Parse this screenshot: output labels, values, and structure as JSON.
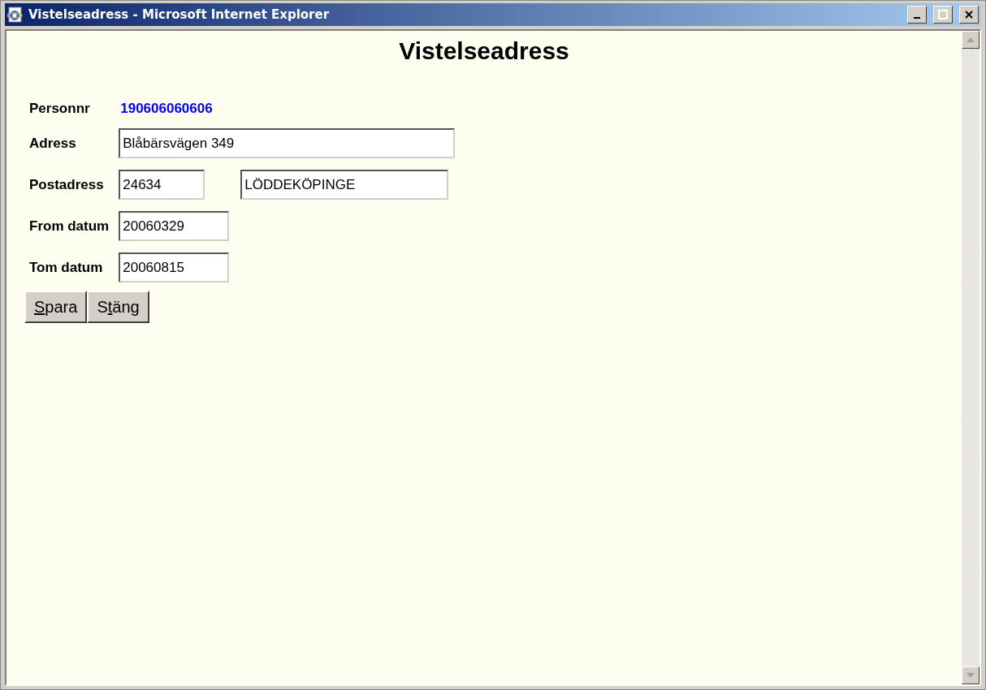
{
  "window": {
    "title": "Vistelseadress - Microsoft Internet Explorer"
  },
  "heading": "Vistelseadress",
  "form": {
    "personnr": {
      "label": "Personnr",
      "value": "190606060606"
    },
    "rows": [
      {
        "label": "Adress",
        "fields": [
          {
            "value": "Blåbärsvägen 349",
            "kind": "wide"
          }
        ]
      },
      {
        "label": "Postadress",
        "fields": [
          {
            "value": "24634",
            "kind": "short"
          },
          {
            "value": "LÖDDEKÖPINGE",
            "kind": "medium"
          }
        ]
      },
      {
        "label": "From datum",
        "fields": [
          {
            "value": "20060329",
            "kind": "date"
          }
        ]
      },
      {
        "label": "Tom datum",
        "fields": [
          {
            "value": "20060815",
            "kind": "date"
          }
        ]
      }
    ]
  },
  "buttons": [
    {
      "accesskey": "S",
      "label_rest": "para"
    },
    {
      "label_start": "S",
      "accesskey": "t",
      "label_rest": "äng"
    }
  ]
}
